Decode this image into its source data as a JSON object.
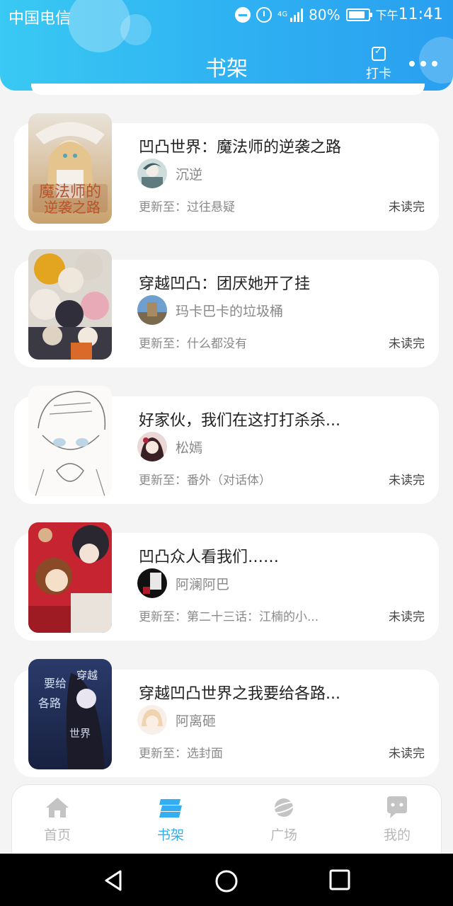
{
  "status": {
    "carrier": "中国电信",
    "network": "4G",
    "battery": "80%",
    "ampm": "下午",
    "time": "11:41"
  },
  "header": {
    "title": "书架",
    "checkin_label": "打卡"
  },
  "books": [
    {
      "title": "凹凸世界：魔法师的逆袭之路",
      "author": "沉逆",
      "update_prefix": "更新至：",
      "update": "过往悬疑",
      "status": "未读完"
    },
    {
      "title": "穿越凹凸：团厌她开了挂",
      "author": "玛卡巴卡的垃圾桶",
      "update_prefix": "更新至：",
      "update": "什么都没有",
      "status": "未读完"
    },
    {
      "title": "好家伙，我们在这打打杀杀...",
      "author": "松嫣",
      "update_prefix": "更新至：",
      "update": "番外（对话体）",
      "status": "未读完"
    },
    {
      "title": "凹凸众人看我们……",
      "author": "阿澜阿巴",
      "update_prefix": "更新至：",
      "update": "第二十三话：江楠的小...",
      "status": "未读完"
    },
    {
      "title": "穿越凹凸世界之我要给各路...",
      "author": "阿离砸",
      "update_prefix": "更新至：",
      "update": "选封面",
      "status": "未读完"
    }
  ],
  "tabs": [
    {
      "label": "首页",
      "icon": "home-icon"
    },
    {
      "label": "书架",
      "icon": "bookshelf-icon",
      "active": true
    },
    {
      "label": "广场",
      "icon": "planet-icon"
    },
    {
      "label": "我的",
      "icon": "chat-bubble-icon"
    }
  ],
  "colors": {
    "accent": "#34aef2",
    "header_start": "#39c9f3",
    "header_end": "#2a9ff0"
  }
}
